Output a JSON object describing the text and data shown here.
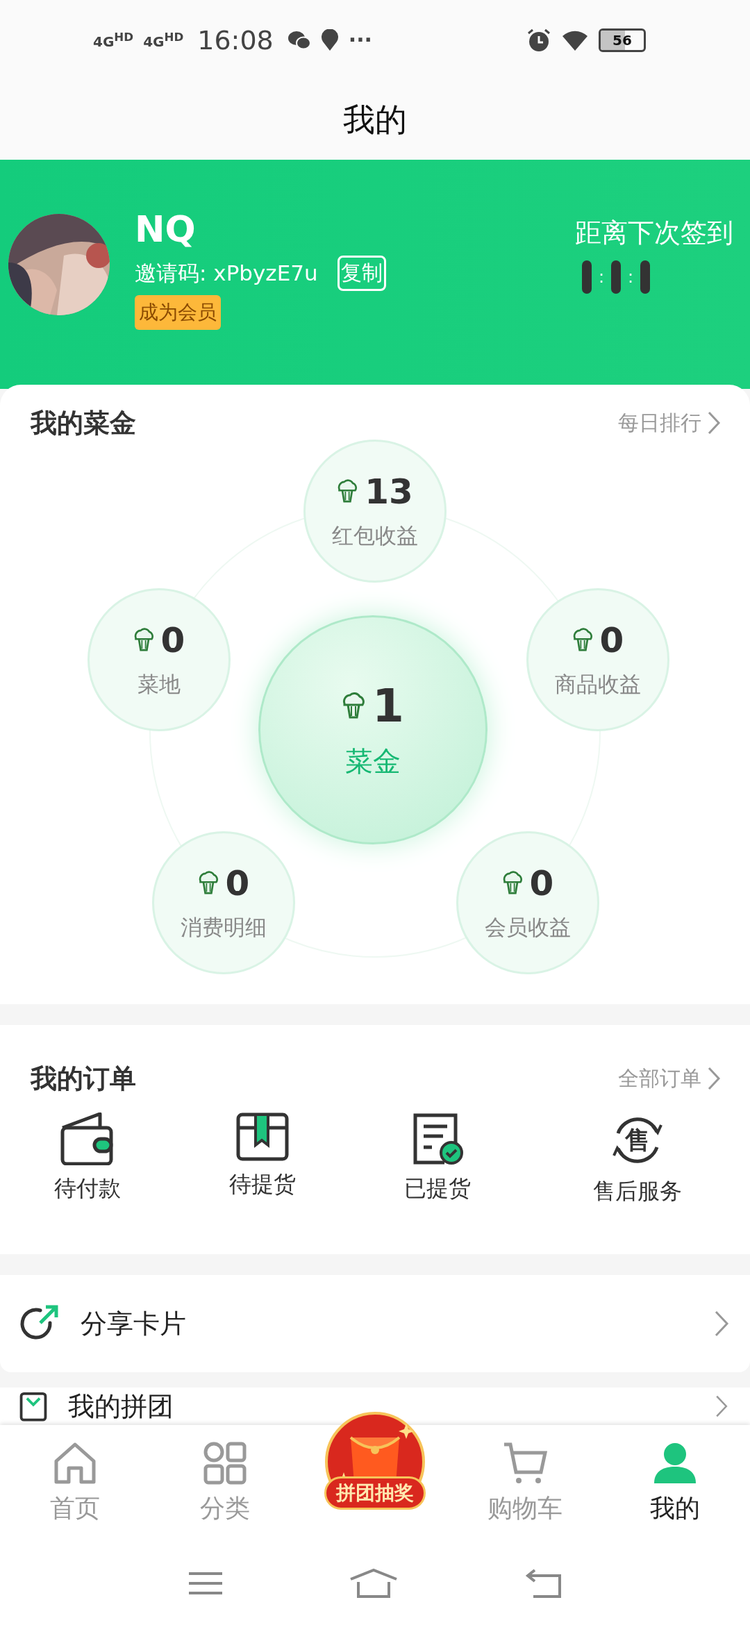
{
  "status_bar": {
    "signals": [
      "4G$^{HD}$",
      "4G$^{HD}$"
    ],
    "time": "16:08",
    "more": "···",
    "battery": "56"
  },
  "header": {
    "title": "我的"
  },
  "profile": {
    "name": "NQ",
    "invite": "邀请码: xPbyzE7u",
    "copy_button": "复制",
    "member_button": "成为会员",
    "checkin_label": "距离下次签到",
    "countdown_separators": [
      ":",
      ":"
    ]
  },
  "balance": {
    "title": "我的菜金",
    "link": "每日排行",
    "center": {
      "value": "1",
      "label": "菜金"
    },
    "items": [
      {
        "value": "13",
        "label": "红包收益"
      },
      {
        "value": "0",
        "label": "菜地"
      },
      {
        "value": "0",
        "label": "商品收益"
      },
      {
        "value": "0",
        "label": "消费明细"
      },
      {
        "value": "0",
        "label": "会员收益"
      }
    ]
  },
  "orders": {
    "title": "我的订单",
    "link": "全部订单",
    "items": [
      {
        "label": "待付款",
        "kind": "wallet"
      },
      {
        "label": "待提货",
        "kind": "box"
      },
      {
        "label": "已提货",
        "kind": "receipt"
      },
      {
        "label": "售后服务",
        "kind": "service",
        "glyph": "售"
      }
    ]
  },
  "menu": [
    {
      "label": "分享卡片",
      "kind": "share"
    },
    {
      "label": "我的拼团",
      "kind": "group"
    }
  ],
  "tab_bar": [
    {
      "label": "首页",
      "kind": "home",
      "selected": false
    },
    {
      "label": "分类",
      "kind": "grid",
      "selected": false
    },
    {
      "label": "拼团抽奖",
      "kind": "promo",
      "selected": false
    },
    {
      "label": "购物车",
      "kind": "cart",
      "selected": false
    },
    {
      "label": "我的",
      "kind": "person",
      "selected": true
    }
  ]
}
